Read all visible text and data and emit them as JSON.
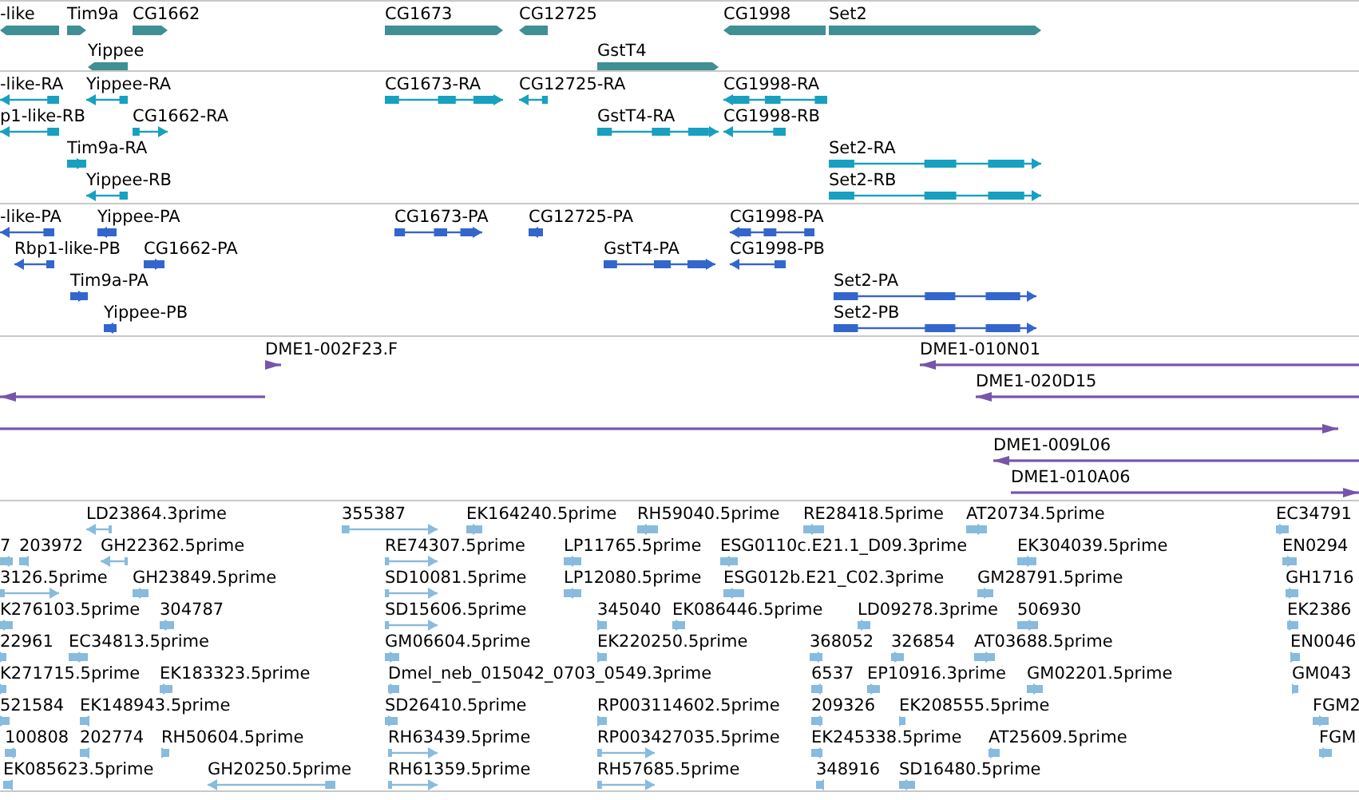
{
  "tracks": [
    {
      "kind": "gene",
      "features": [
        {
          "label": "-like",
          "reverse": true
        },
        {
          "label": "Tim9a",
          "reverse": false
        },
        {
          "label": "CG1662",
          "reverse": false
        },
        {
          "label": "CG1673",
          "reverse": false
        },
        {
          "label": "CG12725",
          "reverse": true
        },
        {
          "label": "CG1998",
          "reverse": true
        },
        {
          "label": "Set2",
          "reverse": false
        },
        {
          "label": "Yippee",
          "reverse": true
        },
        {
          "label": "GstT4",
          "reverse": false
        }
      ]
    },
    {
      "kind": "transcript",
      "features": [
        {
          "label": "-like-RA",
          "reverse": true
        },
        {
          "label": "Yippee-RA",
          "reverse": true
        },
        {
          "label": "CG1673-RA",
          "reverse": false
        },
        {
          "label": "CG12725-RA",
          "reverse": true
        },
        {
          "label": "CG1998-RA",
          "reverse": true
        },
        {
          "label": "p1-like-RB",
          "reverse": true
        },
        {
          "label": "CG1662-RA",
          "reverse": false
        },
        {
          "label": "GstT4-RA",
          "reverse": false
        },
        {
          "label": "CG1998-RB",
          "reverse": true
        },
        {
          "label": "Tim9a-RA",
          "reverse": false
        },
        {
          "label": "Set2-RA",
          "reverse": false
        },
        {
          "label": "Yippee-RB",
          "reverse": true
        },
        {
          "label": "Set2-RB",
          "reverse": false
        }
      ]
    },
    {
      "kind": "protein",
      "features": [
        {
          "label": "-like-PA",
          "reverse": true
        },
        {
          "label": "Yippee-PA",
          "reverse": true
        },
        {
          "label": "CG1673-PA",
          "reverse": false
        },
        {
          "label": "CG12725-PA",
          "reverse": true
        },
        {
          "label": "CG1998-PA",
          "reverse": true
        },
        {
          "label": "Rbp1-like-PB",
          "reverse": true
        },
        {
          "label": "CG1662-PA",
          "reverse": false
        },
        {
          "label": "GstT4-PA",
          "reverse": false
        },
        {
          "label": "CG1998-PB",
          "reverse": true
        },
        {
          "label": "Tim9a-PA",
          "reverse": false
        },
        {
          "label": "Set2-PA",
          "reverse": false
        },
        {
          "label": "Yippee-PB",
          "reverse": true
        },
        {
          "label": "Set2-PB",
          "reverse": false
        }
      ]
    },
    {
      "kind": "clone",
      "features": [
        {
          "label": "DME1-002F23.F",
          "reverse": false
        },
        {
          "label": "DME1-010N01",
          "reverse": true
        },
        {
          "reverse": true
        },
        {
          "label": "DME1-020D15",
          "reverse": true
        },
        {
          "reverse": false
        },
        {
          "label": "DME1-009L06",
          "reverse": true
        },
        {
          "label": "DME1-010A06",
          "reverse": false
        }
      ]
    },
    {
      "kind": "est",
      "features": [
        {
          "label": "LD23864.3prime",
          "reverse": true
        },
        {
          "label": "355387",
          "reverse": false
        },
        {
          "label": "EK164240.5prime",
          "reverse": false
        },
        {
          "label": "RH59040.5prime",
          "reverse": true
        },
        {
          "label": "RE28418.5prime",
          "reverse": true
        },
        {
          "label": "AT20734.5prime",
          "reverse": false
        },
        {
          "label": "EC34791",
          "reverse": false
        },
        {
          "label": "7",
          "reverse": true
        },
        {
          "label": "203972",
          "reverse": true
        },
        {
          "label": "GH22362.5prime",
          "reverse": true
        },
        {
          "label": "RE74307.5prime",
          "reverse": false
        },
        {
          "label": "LP11765.5prime",
          "reverse": true
        },
        {
          "label": "ESG0110c.E21.1_D09.3prime",
          "reverse": true
        },
        {
          "label": "EK304039.5prime",
          "reverse": false
        },
        {
          "label": "EN0294",
          "reverse": false
        },
        {
          "label": "3126.5prime",
          "reverse": false
        },
        {
          "label": "GH23849.5prime",
          "reverse": false
        },
        {
          "label": "SD10081.5prime",
          "reverse": false
        },
        {
          "label": "LP12080.5prime",
          "reverse": true
        },
        {
          "label": "ESG012b.E21_C02.3prime",
          "reverse": true
        },
        {
          "label": "GM28791.5prime",
          "reverse": false
        },
        {
          "label": "GH1716",
          "reverse": false
        },
        {
          "label": "K276103.5prime",
          "reverse": false
        },
        {
          "label": "304787",
          "reverse": false
        },
        {
          "label": "SD15606.5prime",
          "reverse": false
        },
        {
          "label": "345040",
          "reverse": false
        },
        {
          "label": "EK086446.5prime",
          "reverse": false
        },
        {
          "label": "LD09278.3prime",
          "reverse": false
        },
        {
          "label": "506930",
          "reverse": false
        },
        {
          "label": "EK2386",
          "reverse": false
        },
        {
          "label": "22961",
          "reverse": false
        },
        {
          "label": "EC34813.5prime",
          "reverse": false
        },
        {
          "label": "GM06604.5prime",
          "reverse": false
        },
        {
          "label": "EK220250.5prime",
          "reverse": false
        },
        {
          "label": "368052",
          "reverse": true
        },
        {
          "label": "326854",
          "reverse": false
        },
        {
          "label": "AT03688.5prime",
          "reverse": false
        },
        {
          "label": "EN0046",
          "reverse": false
        },
        {
          "label": "K271715.5prime",
          "reverse": false
        },
        {
          "label": "EK183323.5prime",
          "reverse": false
        },
        {
          "label": "Dmel_neb_015042_0703_0549.3prime",
          "reverse": false
        },
        {
          "label": "6537",
          "reverse": true
        },
        {
          "label": "EP10916.3prime",
          "reverse": false
        },
        {
          "label": "GM02201.5prime",
          "reverse": false
        },
        {
          "label": "GM043",
          "reverse": false
        },
        {
          "label": "521584",
          "reverse": false
        },
        {
          "label": "EK148943.5prime",
          "reverse": true
        },
        {
          "label": "SD26410.5prime",
          "reverse": false
        },
        {
          "label": "RP003114602.5prime",
          "reverse": false
        },
        {
          "label": "209326",
          "reverse": true
        },
        {
          "label": "EK208555.5prime",
          "reverse": false
        },
        {
          "label": "FGM2",
          "reverse": false
        },
        {
          "label": "100808",
          "reverse": true
        },
        {
          "label": "202774",
          "reverse": true
        },
        {
          "label": "RH50604.5prime",
          "reverse": false
        },
        {
          "label": "RH63439.5prime",
          "reverse": false
        },
        {
          "label": "RP003427035.5prime",
          "reverse": false
        },
        {
          "label": "EK245338.5prime",
          "reverse": true
        },
        {
          "label": "AT25609.5prime",
          "reverse": false
        },
        {
          "label": "FGM",
          "reverse": false
        },
        {
          "label": "EK085623.5prime",
          "reverse": true
        },
        {
          "label": "GH20250.5prime",
          "reverse": true
        },
        {
          "label": "RH61359.5prime",
          "reverse": false
        },
        {
          "label": "RH57685.5prime",
          "reverse": false
        },
        {
          "label": "348916",
          "reverse": true
        },
        {
          "label": "SD16480.5prime",
          "reverse": false
        }
      ]
    }
  ]
}
